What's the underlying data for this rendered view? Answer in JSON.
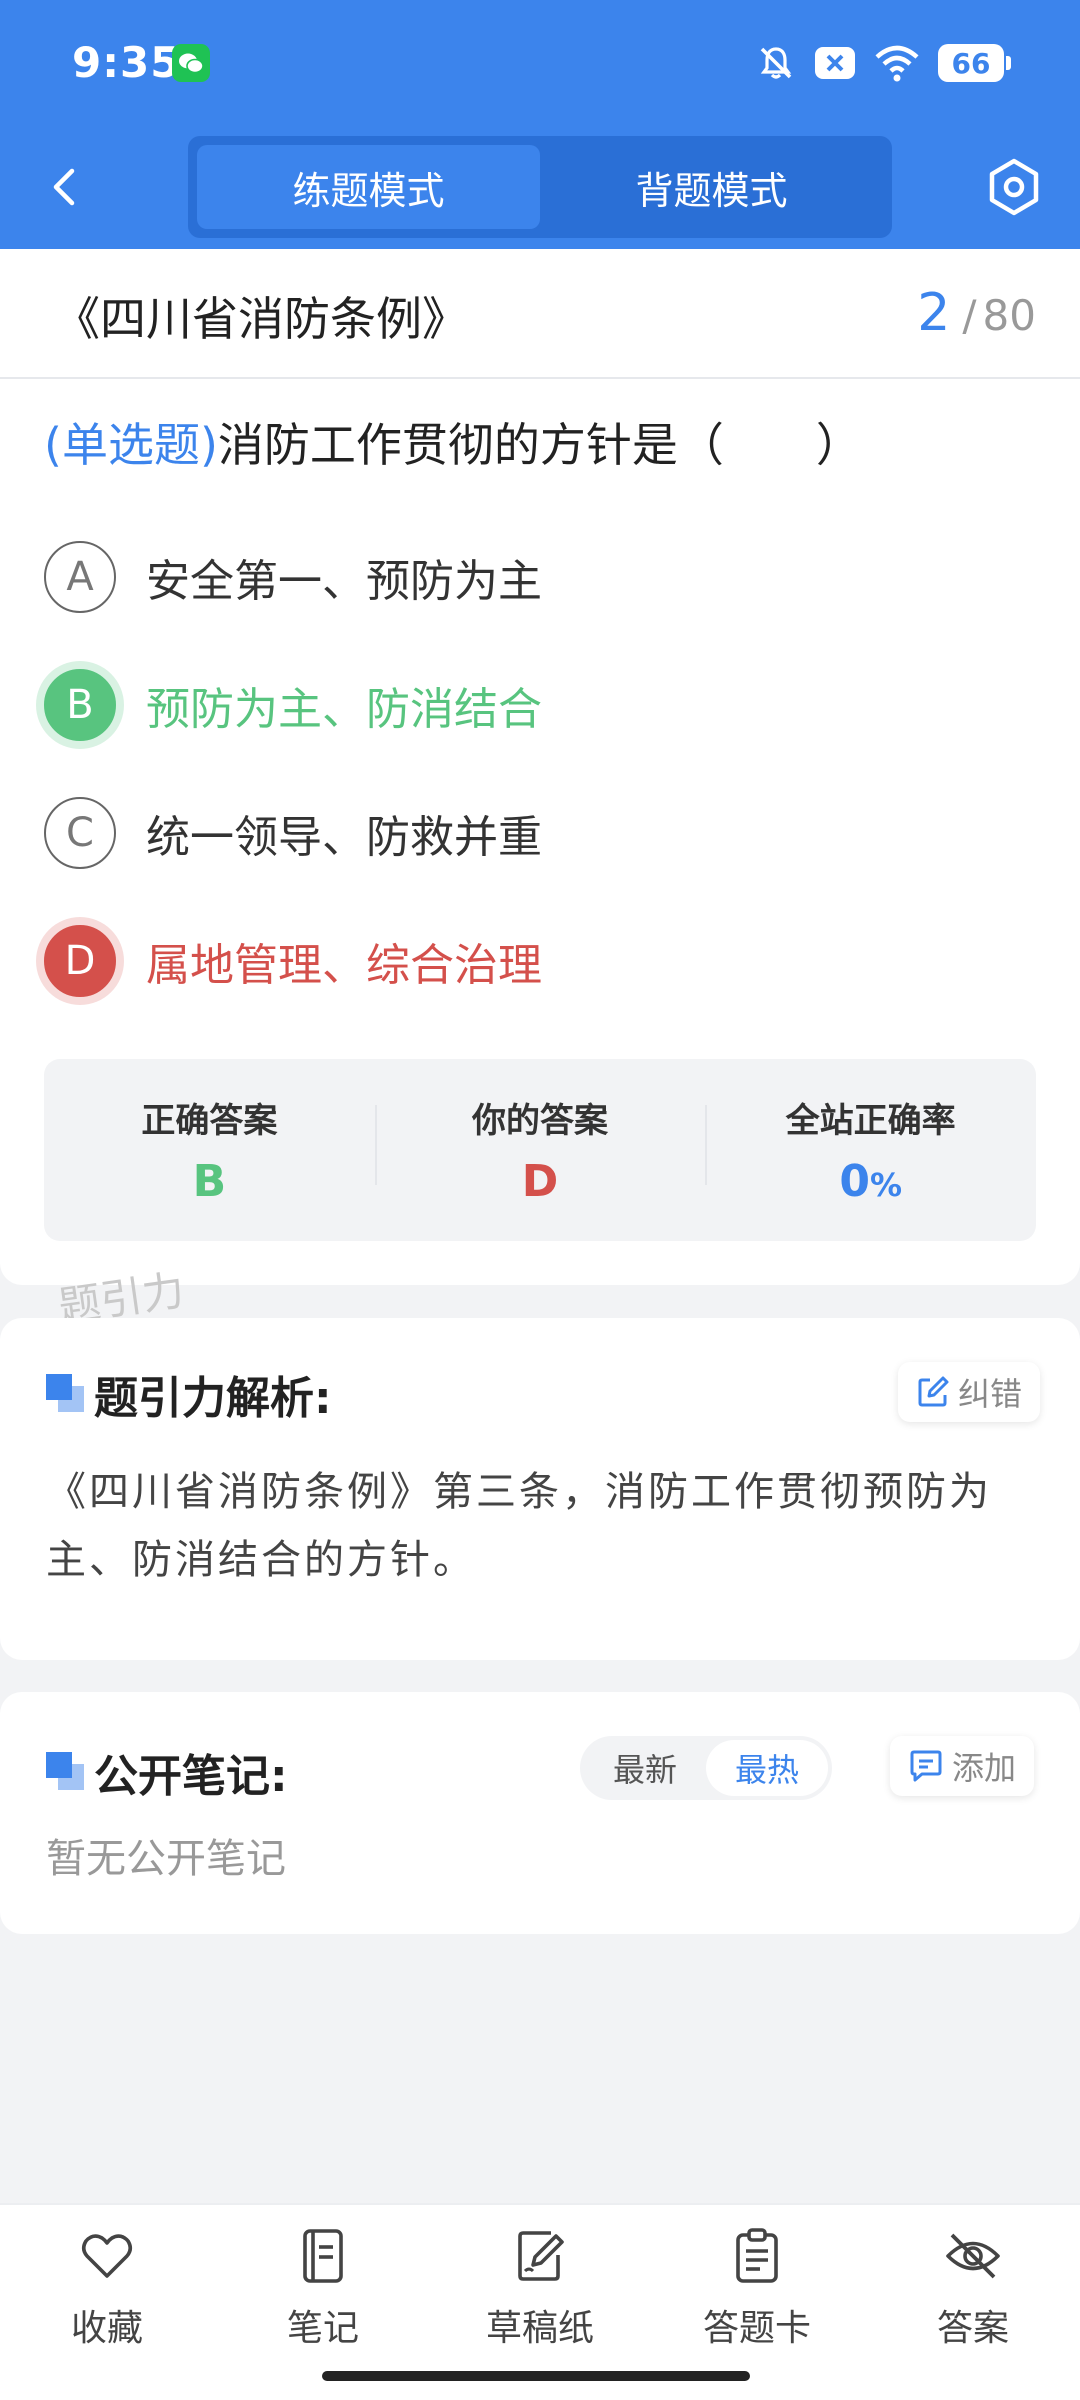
{
  "status_bar": {
    "time": "9:35",
    "battery": "66"
  },
  "nav": {
    "modes": [
      {
        "label": "练题模式",
        "active": true
      },
      {
        "label": "背题模式",
        "active": false
      }
    ]
  },
  "question_card": {
    "doc_title": "《四川省消防条例》",
    "current": "2",
    "separator": "/",
    "total": "80",
    "q_type": "(单选题)",
    "q_text": "消防工作贯彻的方针是（　　）",
    "options": [
      {
        "letter": "A",
        "text": "安全第一、预防为主",
        "state": "normal"
      },
      {
        "letter": "B",
        "text": "预防为主、防消结合",
        "state": "correct"
      },
      {
        "letter": "C",
        "text": "统一领导、防救并重",
        "state": "normal"
      },
      {
        "letter": "D",
        "text": "属地管理、综合治理",
        "state": "wrong"
      }
    ],
    "stats": {
      "correct_label": "正确答案",
      "correct_value": "B",
      "yours_label": "你的答案",
      "yours_value": "D",
      "rate_label": "全站正确率",
      "rate_value": "0",
      "rate_unit": "%"
    }
  },
  "watermark": "题引力",
  "analysis": {
    "title": "题引力解析:",
    "report_label": "纠错",
    "text": "《四川省消防条例》第三条，消防工作贯彻预防为主、防消结合的方针。"
  },
  "notes": {
    "title": "公开笔记:",
    "sort_latest": "最新",
    "sort_hot": "最热",
    "add_label": "添加",
    "empty_text": "暂无公开笔记"
  },
  "bottom_bar": {
    "items": [
      {
        "label": "收藏",
        "icon": "heart-icon"
      },
      {
        "label": "笔记",
        "icon": "notebook-icon"
      },
      {
        "label": "草稿纸",
        "icon": "draft-pen-icon"
      },
      {
        "label": "答题卡",
        "icon": "answer-sheet-icon"
      },
      {
        "label": "答案",
        "icon": "eye-off-icon"
      }
    ]
  },
  "colors": {
    "primary": "#3c84ec",
    "correct": "#58c47f",
    "wrong": "#d4504b"
  }
}
